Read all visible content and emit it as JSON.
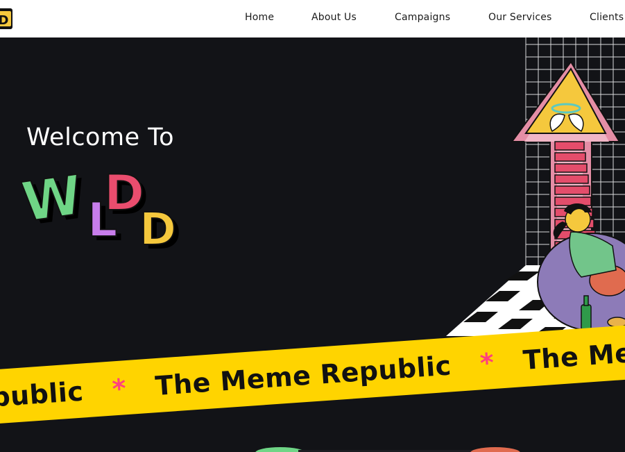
{
  "nav": {
    "items": [
      {
        "label": "Home"
      },
      {
        "label": "About Us"
      },
      {
        "label": "Campaigns"
      },
      {
        "label": "Our Services"
      },
      {
        "label": "Clients"
      }
    ]
  },
  "hero": {
    "welcome": "Welcome To",
    "logo_text": "WLDD",
    "ticker": {
      "fragment_left": "epublic",
      "phrase": "The Meme Republic",
      "fragment_right": "The Meme",
      "separator": "*"
    }
  },
  "colors": {
    "background": "#121317",
    "banner": "#ffd400",
    "star": "#ff3f7f",
    "w": "#6fd586",
    "l": "#c77dea",
    "d1": "#ea4d6e",
    "d2": "#f5c83d"
  }
}
